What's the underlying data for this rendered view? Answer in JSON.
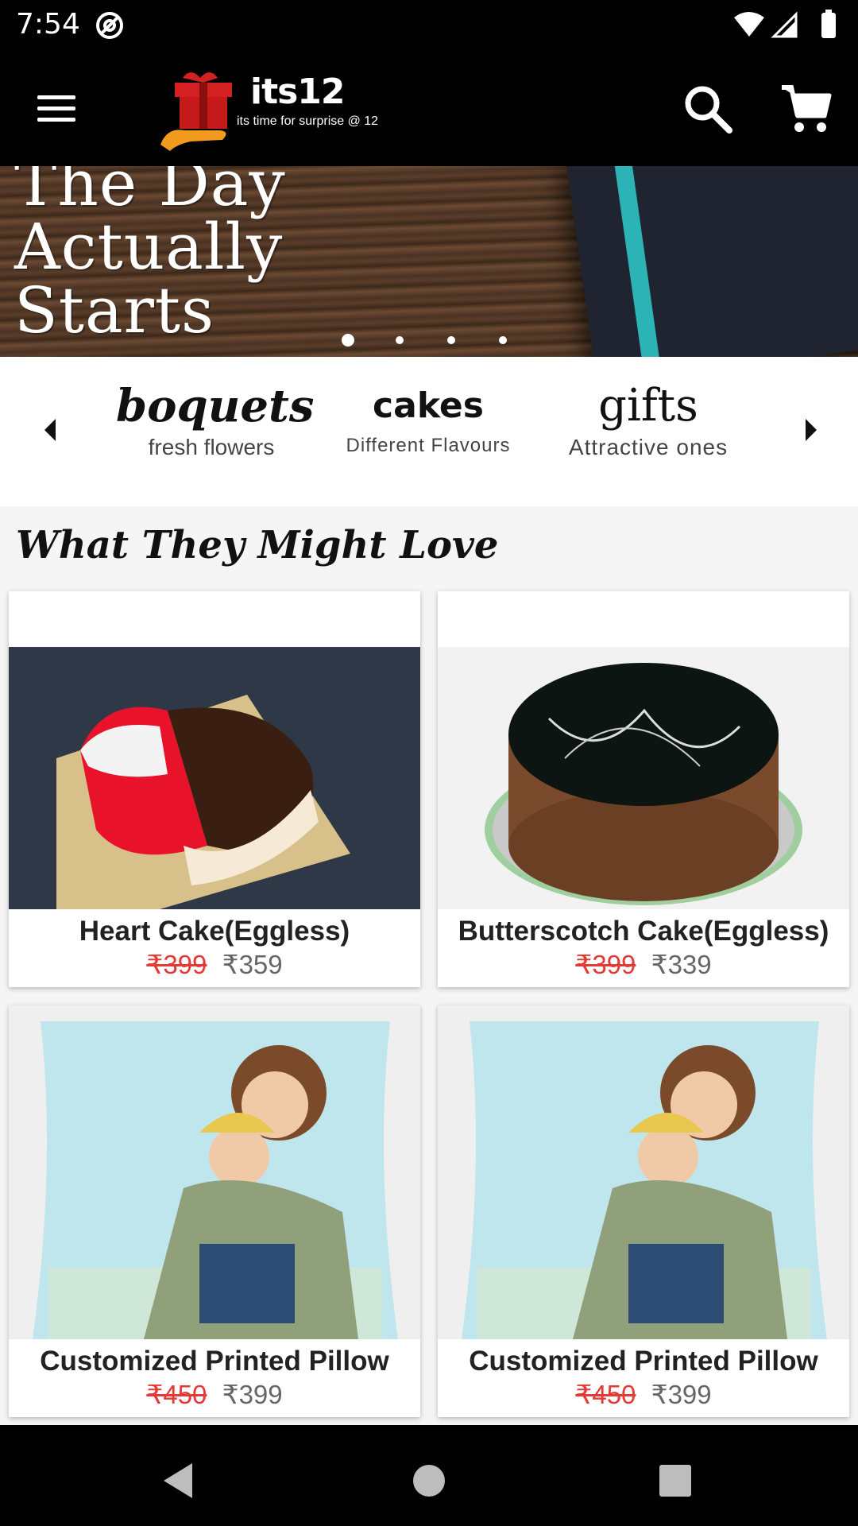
{
  "status_bar": {
    "time": "7:54"
  },
  "toolbar": {
    "menu_icon": "hamburger-menu-icon",
    "logo_title": "its12",
    "logo_tagline": "its time for surprise @ 12",
    "search_icon": "search-icon",
    "cart_icon": "cart-icon"
  },
  "banner": {
    "text": "The Day\nActually\nStarts",
    "slides": 4,
    "active_slide": 1
  },
  "categories": {
    "items": [
      {
        "title": "boquets",
        "subtitle": "fresh flowers"
      },
      {
        "title": "cakes",
        "subtitle": "Different Flavours"
      },
      {
        "title": "gifts",
        "subtitle": "Attractive ones"
      }
    ]
  },
  "section": {
    "title": "What They Might Love"
  },
  "products": [
    {
      "name": "Heart Cake(Eggless)",
      "old_price": "₹399",
      "new_price": "₹359"
    },
    {
      "name": "Butterscotch Cake(Eggless)",
      "old_price": "₹399",
      "new_price": "₹339"
    },
    {
      "name": "Customized Printed Pillow",
      "old_price": "₹450",
      "new_price": "₹399"
    },
    {
      "name": "Customized Printed Pillow",
      "old_price": "₹450",
      "new_price": "₹399"
    }
  ],
  "colors": {
    "strike_price": "#e53935",
    "toolbar_bg": "#000000",
    "banner_ribbon": "#2bb3b5"
  }
}
